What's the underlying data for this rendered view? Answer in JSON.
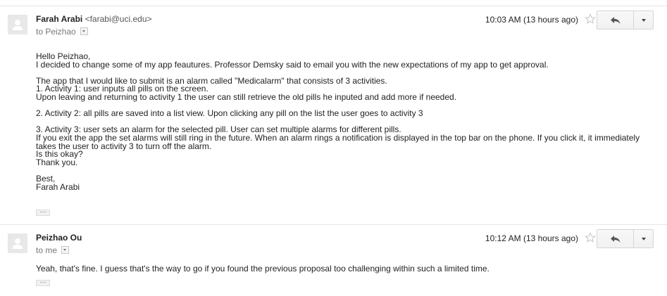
{
  "messages": [
    {
      "sender_name": "Farah Arabi",
      "sender_email": "<farabi@uci.edu>",
      "recipient": "to Peizhao",
      "timestamp": "10:03 AM (13 hours ago)",
      "body": "Hello Peizhao,\nI decided to change some of my app feautures. Professor Demsky said to email you with the new expectations of my app to get approval.\n\nThe app that I would like to submit is an alarm called \"Medicalarm\" that consists of 3 activities.\n1. Activity 1: user inputs all pills on the screen.\nUpon leaving and returning to activity 1 the user can still retrieve the old pills he inputed and add more if needed.\n\n2. Activity 2: all pills are saved into a list view. Upon clicking any pill on the list the user goes to activity 3\n\n3. Activity 3: user sets an alarm for the selected pill.  User can set multiple alarms for different pills.\nIf you exit the app the set alarms will still ring in the future. When an alarm rings a notification is displayed in the top bar on the phone. If you click it, it immediately takes the user to activity 3 to turn off the alarm.\nIs this okay?\nThank you.\n\nBest,\nFarah Arabi",
      "trimmed_content": "···"
    },
    {
      "sender_name": "Peizhao Ou",
      "sender_email": "",
      "recipient": "to me",
      "timestamp": "10:12 AM (13 hours ago)",
      "body": "Yeah, that's fine. I guess that's the way to go if you found the previous proposal too challenging within such a limited time.",
      "trimmed_content": "···"
    }
  ],
  "icons": {
    "avatar": "person-silhouette-icon",
    "star": "star-outline-icon",
    "reply": "reply-arrow-icon",
    "more": "caret-down-icon",
    "details": "small-caret-down-icon"
  },
  "colors": {
    "divider": "#e5e5e5",
    "avatar_bg": "#e8e8e8",
    "avatar_fg": "#ffffff",
    "button_border": "#d6d6d6",
    "secondary_text": "#777777"
  }
}
